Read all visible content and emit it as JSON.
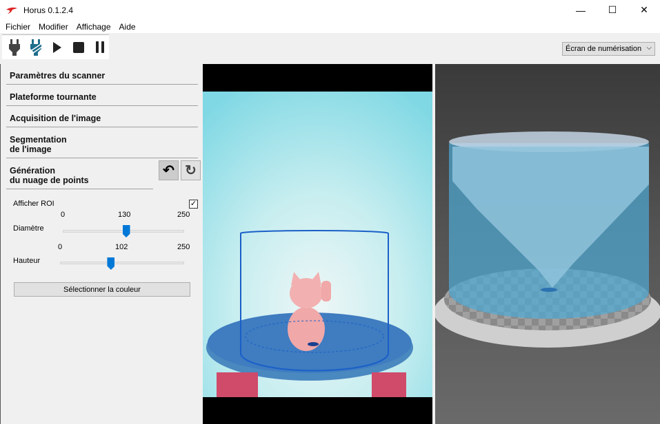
{
  "window": {
    "title": "Horus 0.1.2.4",
    "minimize": "—",
    "maximize": "☐",
    "close": "✕"
  },
  "menu": [
    "Fichier",
    "Modifier",
    "Affichage",
    "Aide"
  ],
  "toolbar": {
    "icons": [
      "connect-icon",
      "disconnect-icon",
      "play-icon",
      "stop-icon",
      "pause-icon"
    ]
  },
  "view_select": {
    "value": "Écran de numérisation"
  },
  "sections": [
    "Paramètres du scanner",
    "Plateforme tournante",
    "Acquisition de l'image",
    "Segmentation",
    "de l'image",
    "Génération",
    "du nuage de points"
  ],
  "controls": {
    "show_roi": {
      "label": "Afficher ROI",
      "checked": true
    },
    "diameter": {
      "label": "Diamètre",
      "min": "0",
      "value": "130",
      "max": "250",
      "fraction": 0.52
    },
    "height": {
      "label": "Hauteur",
      "min": "0",
      "value": "102",
      "max": "250",
      "fraction": 0.408
    },
    "color_button": "Sélectionner la couleur"
  },
  "colors": {
    "accent": "#0078d7",
    "cloud": "#4fa9d6"
  }
}
